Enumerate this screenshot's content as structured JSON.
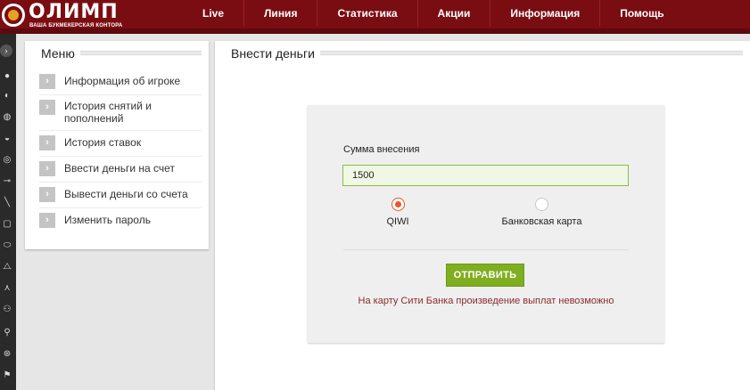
{
  "header": {
    "logo_text": "ОЛИМП",
    "logo_tagline": "ВАША БУКМЕКЕРСКАЯ КОНТОРА",
    "nav": [
      {
        "label": "Live"
      },
      {
        "label": "Линия"
      },
      {
        "label": "Статистика"
      },
      {
        "label": "Акции"
      },
      {
        "label": "Информация"
      },
      {
        "label": "Помощь"
      }
    ],
    "colors": {
      "bar": "#7a0d12",
      "strip": "#5c0a0e"
    }
  },
  "sportbar": {
    "toggle_icon": "chevron-right-icon",
    "icons": [
      "football-icon",
      "basketball-icon",
      "tennis-icon",
      "volleyball-icon",
      "hockey-icon",
      "baseball-icon",
      "handball-icon",
      "boxing-icon",
      "rugby-icon",
      "billiards-icon",
      "skiing-icon",
      "cycling-icon",
      "running-icon",
      "darts-icon",
      "golf-icon",
      "racing-icon"
    ]
  },
  "menu": {
    "title": "Меню",
    "items": [
      {
        "label": "Информация об игроке"
      },
      {
        "label": "История снятий и пополнений"
      },
      {
        "label": "История ставок"
      },
      {
        "label": "Ввести деньги на счет"
      },
      {
        "label": "Вывести деньги со счета"
      },
      {
        "label": "Изменить пароль"
      }
    ]
  },
  "deposit": {
    "title": "Внести деньги",
    "amount_label": "Сумма внесения",
    "amount_value": "1500",
    "methods": [
      {
        "label": "QIWI",
        "selected": true
      },
      {
        "label": "Банковская карта",
        "selected": false
      }
    ],
    "submit_label": "ОТПРАВИТЬ",
    "notice": "На карту Сити Банка произведение выплат невозможно",
    "colors": {
      "accent": "#7fae20",
      "radio": "#e8562e",
      "notice": "#8a2b2b"
    }
  }
}
